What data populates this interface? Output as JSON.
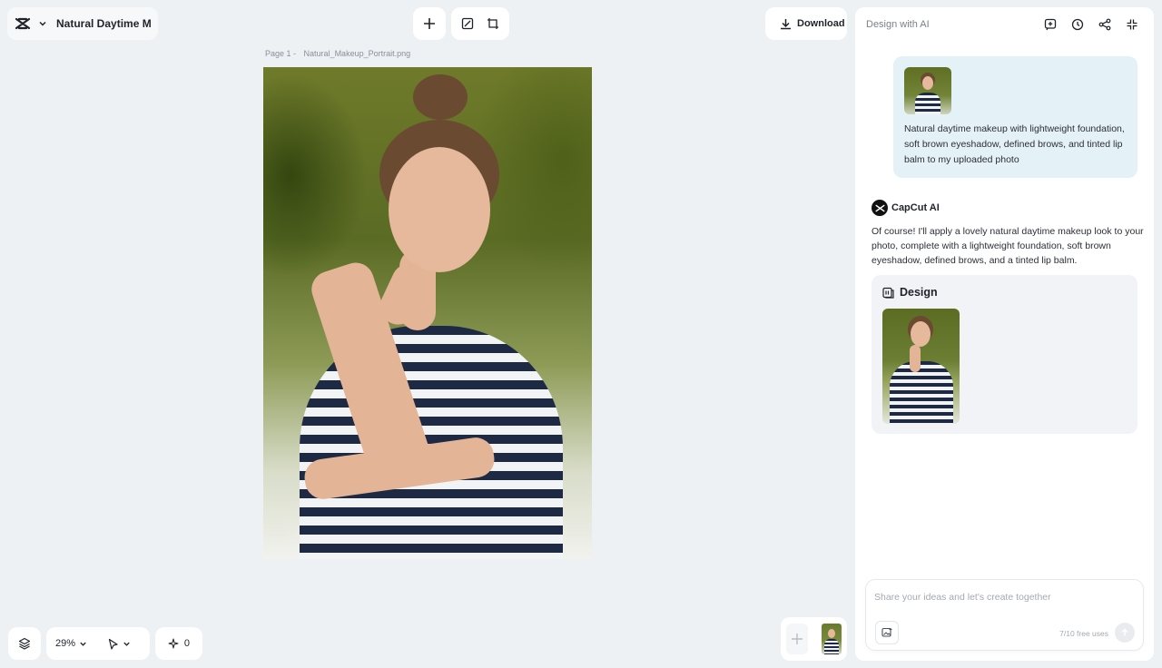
{
  "topbar": {
    "project_title": "Natural Daytime M...",
    "download_label": "Download"
  },
  "canvas": {
    "page_label": "Page 1 -",
    "file_name": "Natural_Makeup_Portrait.png"
  },
  "bottombar": {
    "zoom": "29%",
    "credits": "0"
  },
  "panel": {
    "title": "Design with AI",
    "user_message": "Natural daytime makeup with lightweight foundation, soft brown eyeshadow, defined brows, and tinted lip balm to my uploaded photo",
    "bot_name": "CapCut AI",
    "bot_message": "Of course! I'll apply a lovely natural daytime makeup look to your photo, complete with a lightweight foundation, soft brown eyeshadow, defined brows, and a tinted lip balm.",
    "design_label": "Design",
    "composer_placeholder": "Share your ideas and let's create together",
    "free_uses": "7/10 free uses"
  },
  "icons": {
    "logo": "capcut-logo-icon",
    "add": "plus-icon",
    "resize": "resize-icon",
    "crop": "crop-icon",
    "download": "download-icon",
    "new_chat": "new-chat-icon",
    "history": "history-icon",
    "share": "share-icon",
    "collapse": "collapse-icon",
    "layers": "layers-icon",
    "select": "pointer-icon",
    "credits": "sparkle-icon",
    "image_upload": "image-upload-icon",
    "send": "send-arrow-icon"
  },
  "colors": {
    "background": "#eef1f4",
    "panel": "#ffffff",
    "user_bubble": "#e4f1f6",
    "design_card": "#f1f3f6"
  }
}
